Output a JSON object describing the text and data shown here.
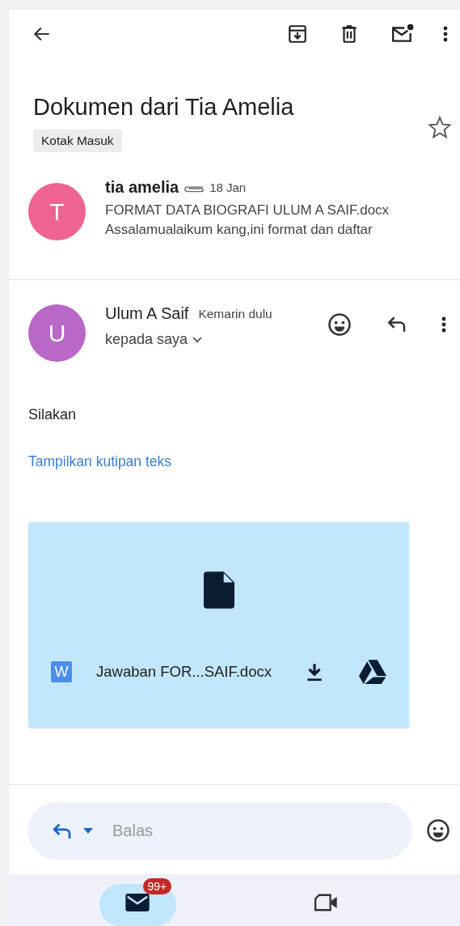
{
  "toolbar": {
    "actions": [
      {
        "kind": "archive"
      },
      {
        "kind": "delete"
      },
      {
        "kind": "mark-unread"
      },
      {
        "kind": "more"
      }
    ]
  },
  "subject": "Dokumen dari Tia Amelia",
  "label": "Kotak Masuk",
  "starred": false,
  "thread": [
    {
      "kind": "collapsed",
      "initial": "T",
      "color": "#ef6392",
      "sender": "tia amelia",
      "has_attachment": true,
      "date": "18 Jan",
      "subject_line": "FORMAT DATA BIOGRAFI ULUM A SAIF.docx",
      "snippet": "Assalamualaikum kang,ini format dan daftar"
    },
    {
      "kind": "expanded",
      "initial": "U",
      "color": "#b968c7",
      "sender": "Ulum A Saif",
      "date": "Kemarin dulu",
      "recipient": "kepada saya",
      "body": "Silakan",
      "quote_link": "Tampilkan kutipan teks",
      "attachment": {
        "filename": "Jawaban FOR...SAIF.docx",
        "type_letter": "W"
      }
    }
  ],
  "reply": {
    "placeholder": "Balas"
  },
  "nav": [
    {
      "kind": "mail",
      "selected": true,
      "badge": "99+"
    },
    {
      "kind": "meet",
      "selected": false
    }
  ]
}
